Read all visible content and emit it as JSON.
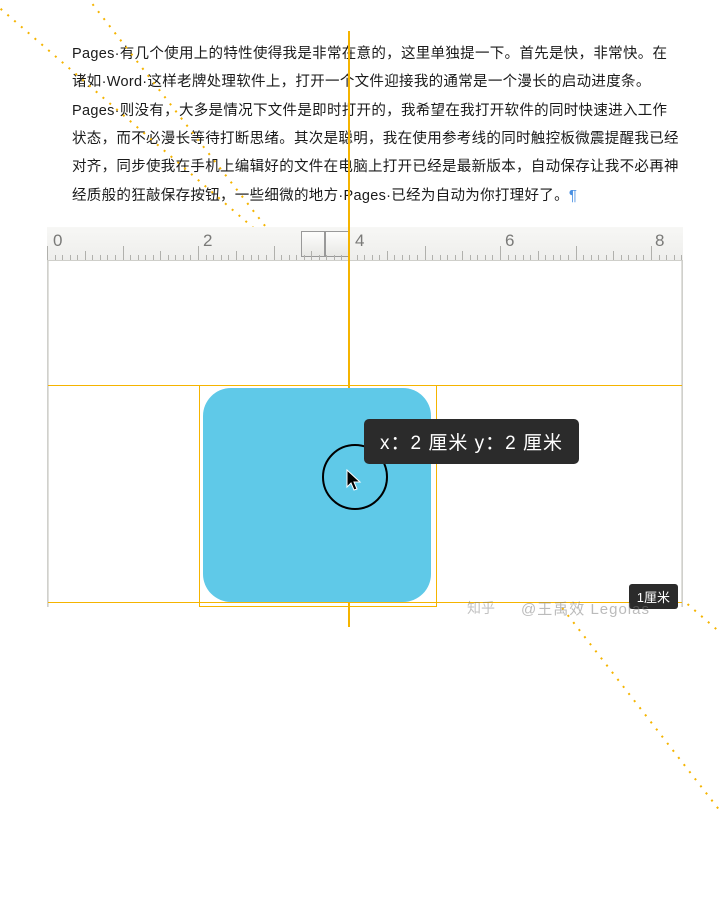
{
  "article": {
    "body": "Pages·有几个使用上的特性使得我是非常在意的，这里单独提一下。首先是快，非常快。在诸如·Word·这样老牌处理软件上，打开一个文件迎接我的通常是一个漫长的启动进度条。Pages·则没有，大多是情况下文件是即时打开的，我希望在我打开软件的同时快速进入工作状态，而不必漫长等待打断思绪。其次是聪明，我在使用参考线的同时触控板微震提醒我已经对齐，同步使我在手机上编辑好的文件在电脑上打开已经是最新版本，自动保存让我不必再神经质般的狂敲保存按钮，一些细微的地方·Pages·已经为自动为你打理好了。",
    "pilcrow": "¶"
  },
  "ruler": {
    "labels": [
      "0",
      "2",
      "4",
      "6",
      "8"
    ]
  },
  "shape": {
    "tooltip": "x：2 厘米 y：2 厘米",
    "bottom_tooltip": "1厘米"
  },
  "watermark": {
    "brand": "知乎",
    "author": "@王禹效 Legolas"
  }
}
